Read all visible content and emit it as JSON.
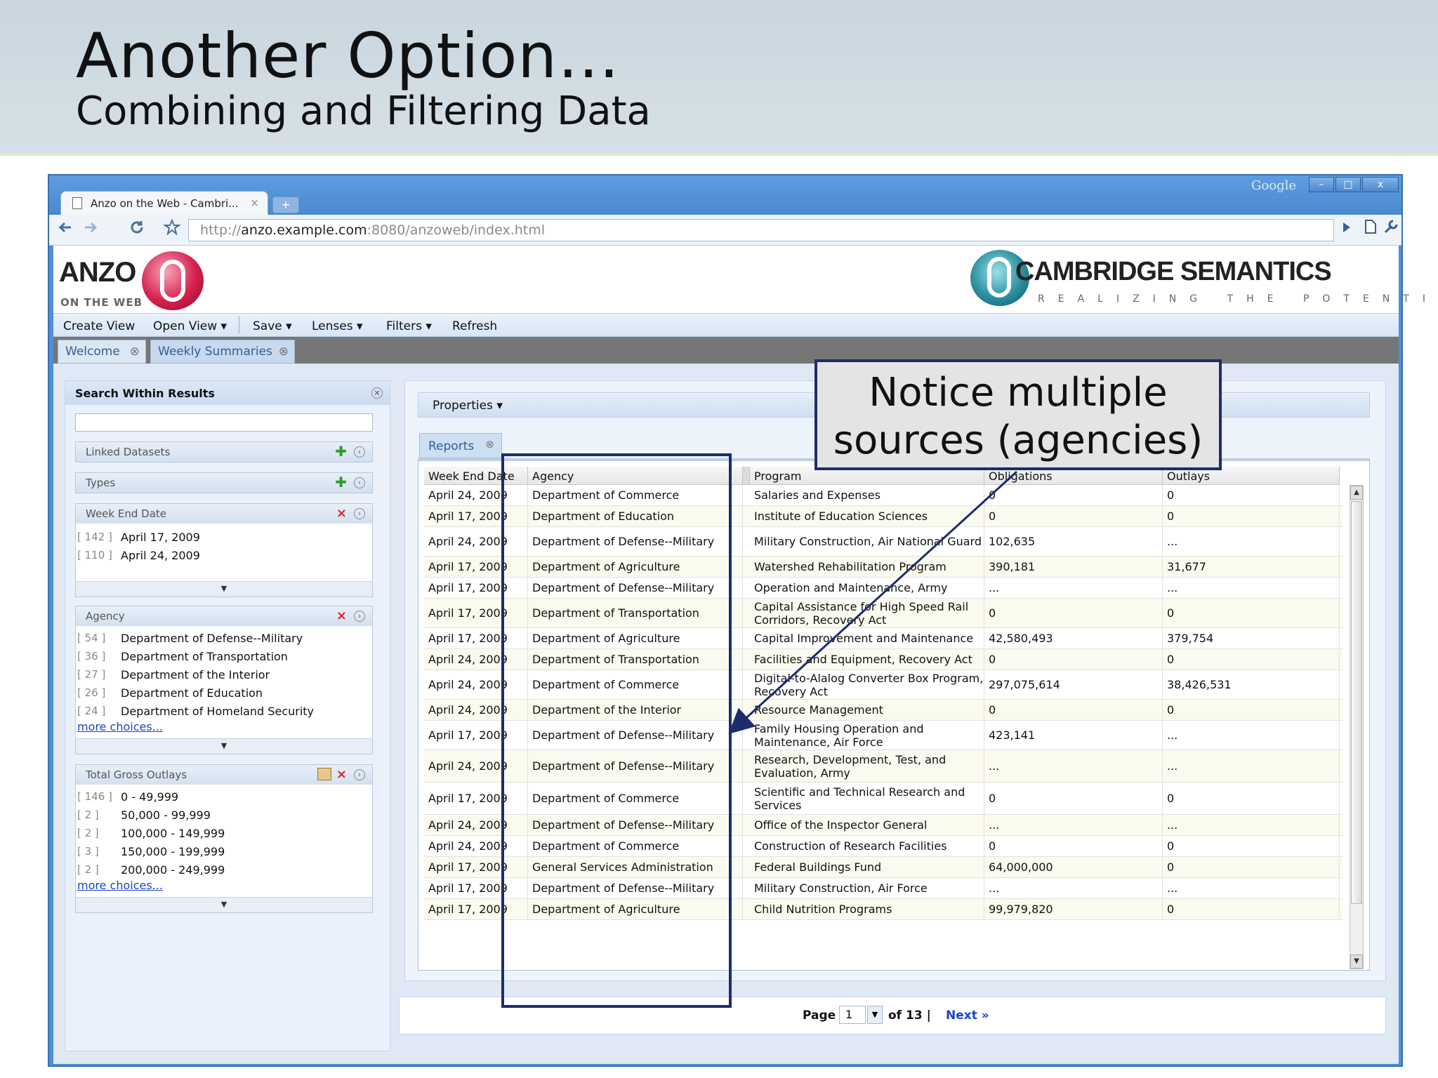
{
  "slide": {
    "title": "Another Option…",
    "subtitle": "Combining and Filtering Data"
  },
  "browser": {
    "google_label": "Google",
    "tab_title": "Anzo on the Web - Cambri...",
    "tab_close": "×",
    "new_tab": "+",
    "url_prefix": "http://",
    "url_host": "anzo.example.com",
    "url_rest": ":8080/anzoweb/index.html",
    "win_minimize": "–",
    "win_maximize": "□",
    "win_close": "x",
    "icons": [
      "back-arrow-icon",
      "forward-arrow-icon",
      "reload-icon",
      "star-icon",
      "go-icon",
      "page-menu-icon",
      "wrench-icon"
    ]
  },
  "app": {
    "anzo_logo_text": "ANZO",
    "anzo_logo_sub": "ON THE WEB",
    "cs_logo_text": "CAMBRIDGE SEMANTICS",
    "cs_logo_tag": "REALIZING THE POTENTIAL",
    "menu": [
      "Create View",
      "Open View ▾",
      "Save ▾",
      "Lenses ▾",
      "Filters ▾",
      "Refresh"
    ],
    "view_tabs": [
      {
        "label": "Welcome",
        "close": "⊗"
      },
      {
        "label": "Weekly Summaries",
        "close": "⊗"
      }
    ]
  },
  "sidebar": {
    "title": "Search Within Results",
    "search_value": "",
    "linked_datasets": "Linked Datasets",
    "types": "Types",
    "week_end_date": {
      "label": "Week End Date",
      "items": [
        {
          "count": "[ 142 ]",
          "name": "April 17, 2009"
        },
        {
          "count": "[ 110 ]",
          "name": "April 24, 2009"
        }
      ]
    },
    "agency": {
      "label": "Agency",
      "items": [
        {
          "count": "[ 54 ]",
          "name": "Department of Defense--Military"
        },
        {
          "count": "[ 36 ]",
          "name": "Department of Transportation"
        },
        {
          "count": "[ 27 ]",
          "name": "Department of the Interior"
        },
        {
          "count": "[ 26 ]",
          "name": "Department of Education"
        },
        {
          "count": "[ 24 ]",
          "name": "Department of Homeland Security"
        }
      ],
      "more": "more choices..."
    },
    "total_gross_outlays": {
      "label": "Total Gross Outlays",
      "items": [
        {
          "count": "[ 146 ]",
          "name": "0 - 49,999"
        },
        {
          "count": "[ 2 ]",
          "name": "50,000 - 99,999"
        },
        {
          "count": "[ 2 ]",
          "name": "100,000 - 149,999"
        },
        {
          "count": "[ 3 ]",
          "name": "150,000 - 199,999"
        },
        {
          "count": "[ 2 ]",
          "name": "200,000 - 249,999"
        }
      ],
      "more": "more choices..."
    }
  },
  "main": {
    "properties": "Properties ▾",
    "reports_tab": "Reports",
    "columns": [
      "Week End Date",
      "Agency",
      "Program",
      "Obligations",
      "Outlays"
    ],
    "rows": [
      [
        "April 24, 2009",
        "Department of Commerce",
        "Salaries and Expenses",
        "0",
        "0"
      ],
      [
        "April 17, 2009",
        "Department of Education",
        "Institute of Education Sciences",
        "0",
        "0"
      ],
      [
        "April 24, 2009",
        "Department of Defense--Military",
        "Military Construction, Air National Guard",
        "102,635",
        "..."
      ],
      [
        "April 17, 2009",
        "Department of Agriculture",
        "Watershed Rehabilitation Program",
        "390,181",
        "31,677"
      ],
      [
        "April 17, 2009",
        "Department of Defense--Military",
        "Operation and Maintenance, Army",
        "...",
        "..."
      ],
      [
        "April 17, 2009",
        "Department of Transportation",
        "Capital Assistance for High Speed Rail Corridors, Recovery Act",
        "0",
        "0"
      ],
      [
        "April 17, 2009",
        "Department of Agriculture",
        "Capital Improvement and Maintenance",
        "42,580,493",
        "379,754"
      ],
      [
        "April 24, 2009",
        "Department of Transportation",
        "Facilities and Equipment, Recovery Act",
        "0",
        "0"
      ],
      [
        "April 24, 2009",
        "Department of Commerce",
        "Digital-to-Alalog Converter Box Program, Recovery Act",
        "297,075,614",
        "38,426,531"
      ],
      [
        "April 24, 2009",
        "Department of the Interior",
        "Resource Management",
        "0",
        "0"
      ],
      [
        "April 17, 2009",
        "Department of Defense--Military",
        "Family Housing Operation and Maintenance, Air Force",
        "423,141",
        "..."
      ],
      [
        "April 24, 2009",
        "Department of Defense--Military",
        "Research, Development, Test, and Evaluation, Army",
        "...",
        "..."
      ],
      [
        "April 17, 2009",
        "Department of Commerce",
        "Scientific and Technical Research and Services",
        "0",
        "0"
      ],
      [
        "April 24, 2009",
        "Department of Defense--Military",
        "Office of the Inspector General",
        "...",
        "..."
      ],
      [
        "April 24, 2009",
        "Department of Commerce",
        "Construction of Research Facilities",
        "0",
        "0"
      ],
      [
        "April 17, 2009",
        "General Services Administration",
        "Federal Buildings Fund",
        "64,000,000",
        "0"
      ],
      [
        "April 17, 2009",
        "Department of Defense--Military",
        "Military Construction, Air Force",
        "...",
        "..."
      ],
      [
        "April 17, 2009",
        "Department of Agriculture",
        "Child Nutrition Programs",
        "99,979,820",
        "0"
      ]
    ],
    "pager": {
      "page_label": "Page",
      "page_value": "1",
      "of_label": "of 13 |",
      "next_label": "Next »"
    }
  },
  "callout": {
    "line1": "Notice multiple",
    "line2": "sources (agencies)"
  },
  "colors": {
    "annotation": "#1c2d6e",
    "browser_frame": "#4f8fd8",
    "link": "#1a44cc"
  }
}
